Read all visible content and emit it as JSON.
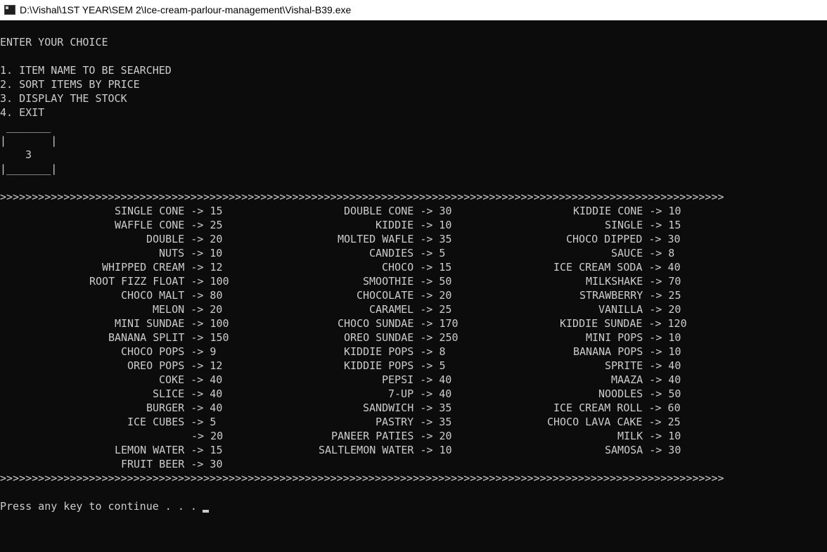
{
  "window": {
    "title": "D:\\Vishal\\1ST YEAR\\SEM 2\\Ice-cream-parlour-management\\Vishal-B39.exe",
    "icon": "console-app-icon"
  },
  "menu": {
    "prompt": "ENTER YOUR CHOICE",
    "options": [
      "1. ITEM NAME TO BE SEARCHED",
      "2. SORT ITEMS BY PRICE",
      "3. DISPLAY THE STOCK",
      "4. EXIT"
    ]
  },
  "choice_box": {
    "top": " _______",
    "side": "|       |",
    "value": "3",
    "bottom": "|_______|"
  },
  "separator": ">>>>>>>>>>>>>>>>>>>>>>>>>>>>>>>>>>>>>>>>>>>>>>>>>>>>>>>>>>>>>>>>>>>>>>>>>>>>>>>>>>>>>>>>>>>>>>>>>>>>>>>>>>>>>>>>>>",
  "stock": [
    {
      "col1": "SINGLE CONE -> 15",
      "col2": "DOUBLE CONE -> 30",
      "col3": "KIDDIE CONE -> 10"
    },
    {
      "col1": "WAFFLE CONE -> 25",
      "col2": "KIDDIE -> 10",
      "col3": "SINGLE -> 15"
    },
    {
      "col1": "DOUBLE -> 20",
      "col2": "MOLTED WAFLE -> 35",
      "col3": "CHOCO DIPPED -> 30"
    },
    {
      "col1": "NUTS -> 10",
      "col2": "CANDIES -> 5",
      "col3": "SAUCE -> 8"
    },
    {
      "col1": "WHIPPED CREAM -> 12",
      "col2": "CHOCO -> 15",
      "col3": "ICE CREAM SODA -> 40"
    },
    {
      "col1": "ROOT FIZZ FLOAT -> 100",
      "col2": "SMOOTHIE -> 50",
      "col3": "MILKSHAKE -> 70"
    },
    {
      "col1": "CHOCO MALT -> 80",
      "col2": "CHOCOLATE -> 20",
      "col3": "STRAWBERRY -> 25"
    },
    {
      "col1": "MELON -> 20",
      "col2": "CARAMEL -> 25",
      "col3": "VANILLA -> 20"
    },
    {
      "col1": "MINI SUNDAE -> 100",
      "col2": "CHOCO SUNDAE -> 170",
      "col3": "KIDDIE SUNDAE -> 120"
    },
    {
      "col1": "BANANA SPLIT -> 150",
      "col2": "OREO SUNDAE -> 250",
      "col3": "MINI POPS -> 10"
    },
    {
      "col1": "CHOCO POPS -> 9",
      "col2": "KIDDIE POPS -> 8",
      "col3": "BANANA POPS -> 10"
    },
    {
      "col1": "OREO POPS -> 12",
      "col2": "KIDDIE POPS -> 5",
      "col3": "SPRITE -> 40"
    },
    {
      "col1": "COKE -> 40",
      "col2": "PEPSI -> 40",
      "col3": "MAAZA -> 40"
    },
    {
      "col1": "SLICE -> 40",
      "col2": "7-UP -> 40",
      "col3": "NOODLES -> 50"
    },
    {
      "col1": "BURGER -> 40",
      "col2": "SANDWICH -> 35",
      "col3": "ICE CREAM ROLL -> 60"
    },
    {
      "col1": "ICE CUBES -> 5",
      "col2": "PASTRY -> 35",
      "col3": "CHOCO LAVA CAKE -> 25"
    },
    {
      "col1": "-> 20",
      "col2": "PANEER PATIES -> 20",
      "col3": "MILK -> 10"
    },
    {
      "col1": "LEMON WATER -> 15",
      "col2": "SALTLEMON WATER -> 10",
      "col3": "SAMOSA -> 30"
    },
    {
      "col1": "FRUIT BEER -> 30",
      "col2": "",
      "col3": ""
    }
  ],
  "footer": {
    "continue_prompt": "Press any key to continue . . . "
  }
}
